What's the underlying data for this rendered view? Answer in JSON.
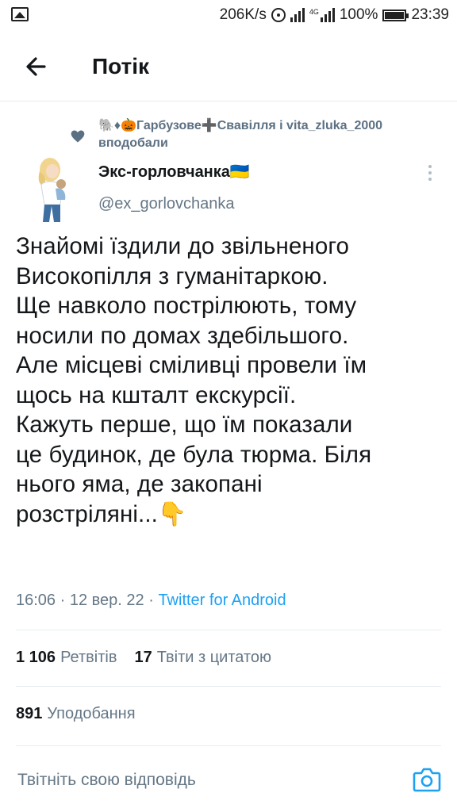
{
  "status_bar": {
    "speed": "206K/s",
    "battery": "100%",
    "time": "23:39",
    "network": "4G"
  },
  "header": {
    "title": "Потік"
  },
  "social_context": {
    "prefix_emoji": "🐘♦🎃",
    "name1": "Гарбузове",
    "cross": "➕",
    "name2": "Свавілля",
    "rest": " і vita_zluka_2000",
    "action": "вподобали"
  },
  "author": {
    "name": "Экс-горловчанка",
    "flag": "🇺🇦",
    "handle": "@ex_gorlovchanka"
  },
  "tweet": {
    "lines": [
      "Знайомі їздили до звільненого",
      "Високопілля з гуманітаркою.",
      "Ще навколо пострілюють, тому",
      "носили по домах здебільшого.",
      "Але місцеві сміливці провели їм",
      "щось на кшталт екскурсії.",
      "Кажуть перше, що їм показали",
      "це будинок, де була тюрма. Біля",
      "нього яма, де закопані",
      "розстріляні..."
    ],
    "end_emoji": "👇",
    "time": "16:06",
    "separator": " · ",
    "date": "12 вер. 22",
    "source": "Twitter for Android"
  },
  "stats": {
    "retweets_count": "1 106",
    "retweets_label": "Ретвітів",
    "quotes_count": "17",
    "quotes_label": "Твіти з цитатою",
    "likes_count": "891",
    "likes_label": "Уподобання"
  },
  "reply": {
    "placeholder": "Твітніть свою відповідь"
  },
  "colors": {
    "accent": "#1da1f2",
    "secondary_text": "#657786",
    "context_text": "#5b7083",
    "divider": "#e6ecf0"
  },
  "icons": [
    "image-icon",
    "hotspot-icon",
    "signal-icon",
    "battery-icon",
    "back-arrow-icon",
    "heart-icon",
    "more-vertical-icon",
    "camera-icon"
  ]
}
